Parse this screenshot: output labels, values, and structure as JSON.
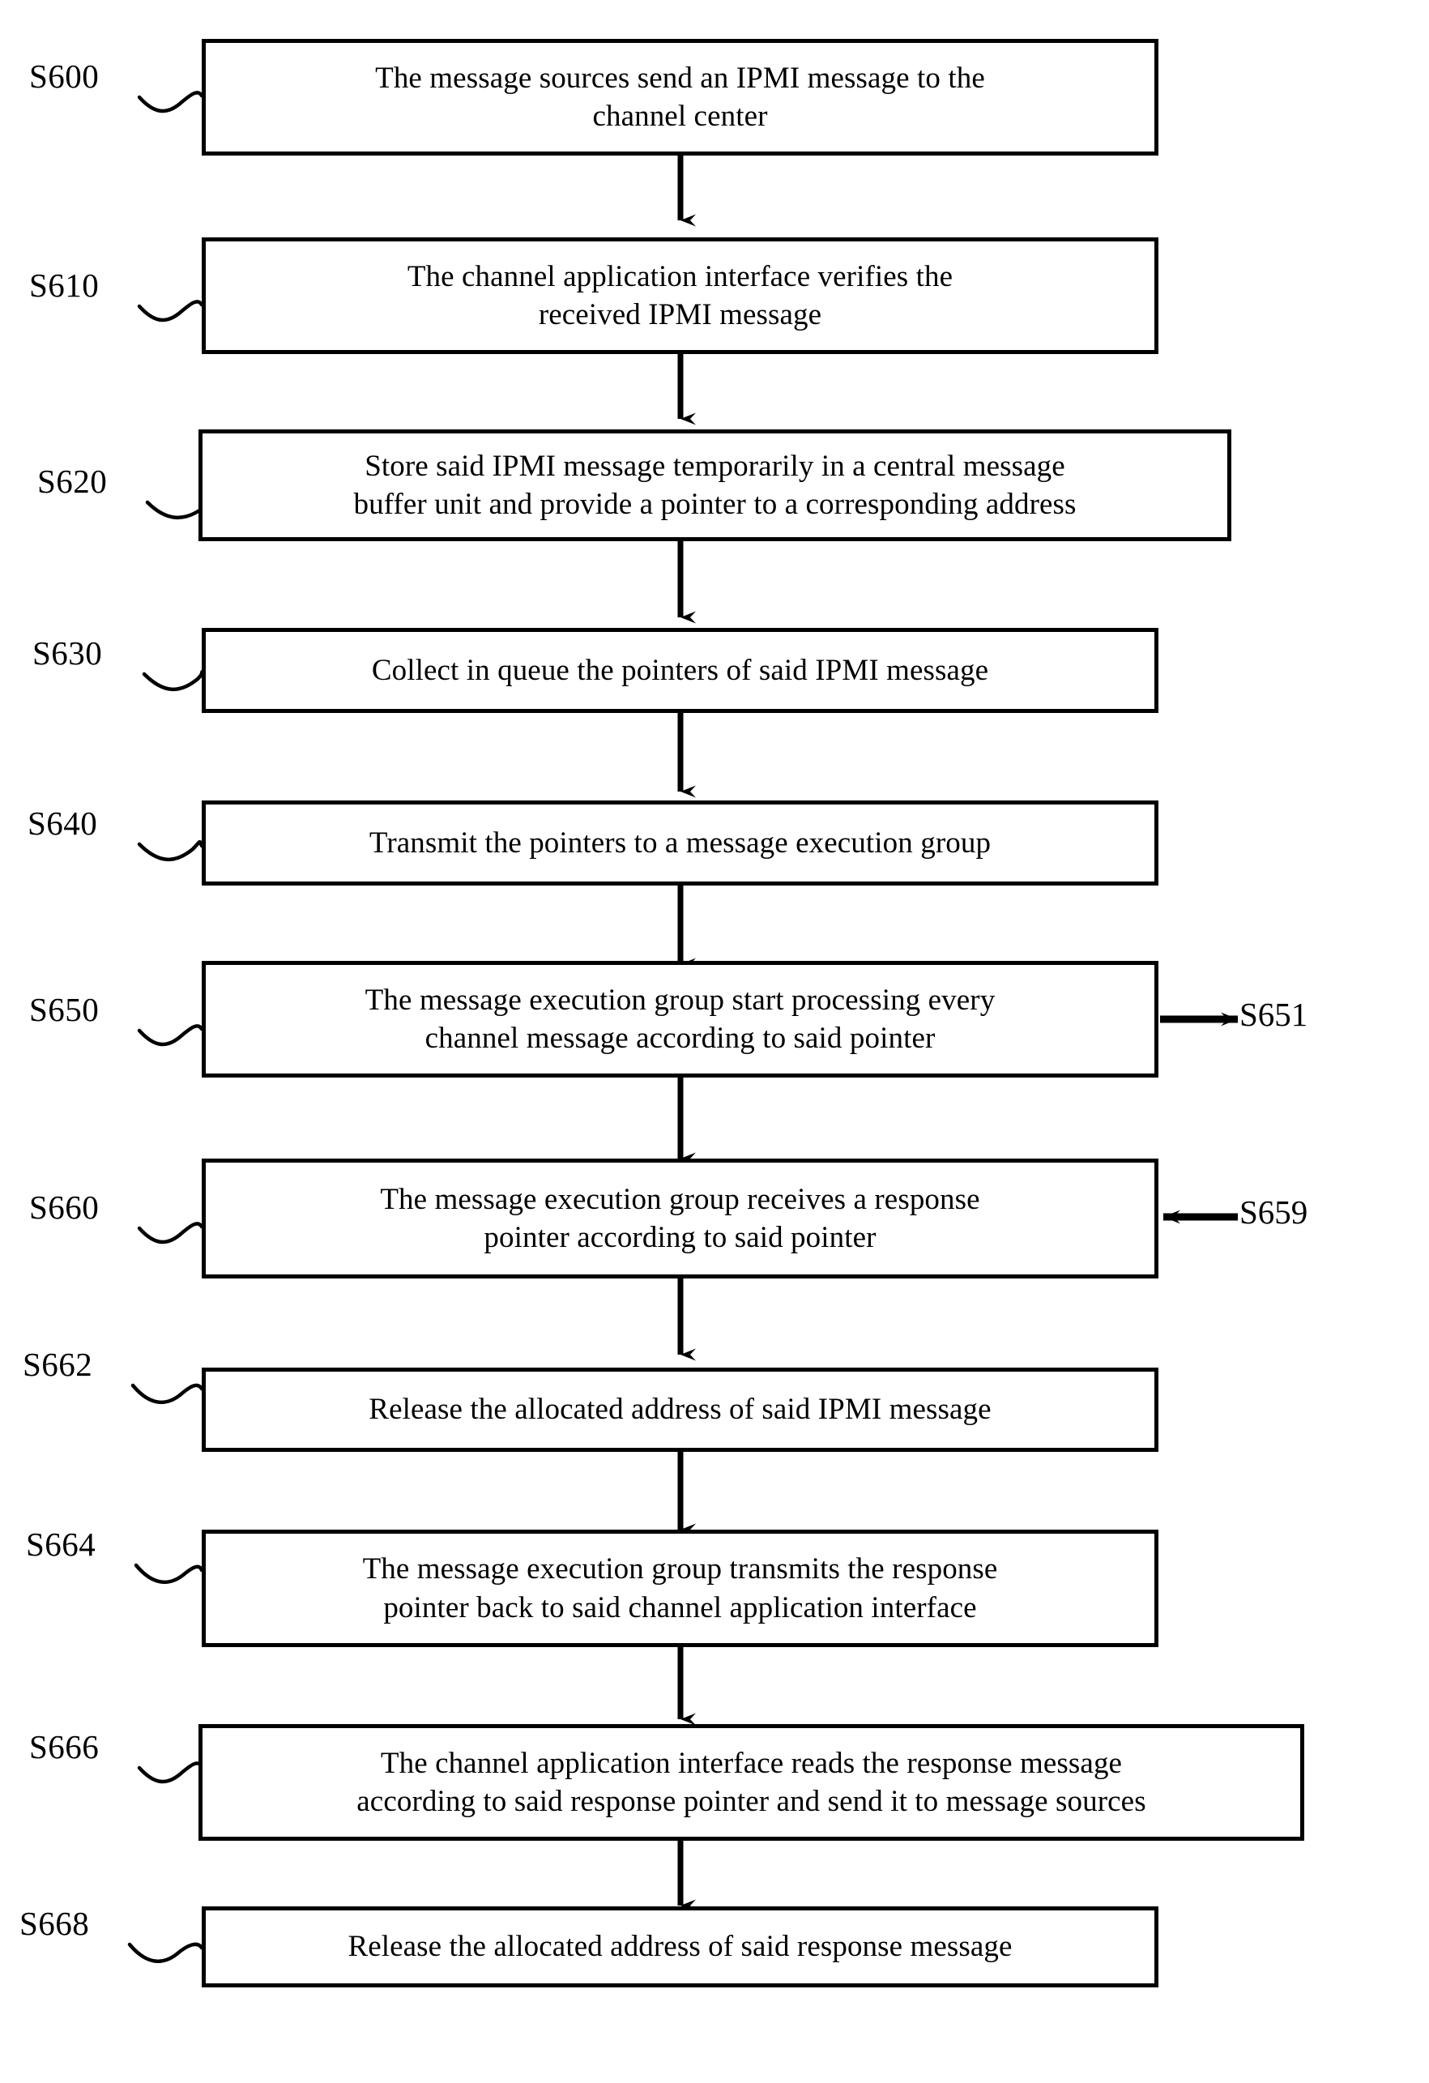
{
  "diagram": {
    "kind": "patent-flowchart",
    "line_color": "#000000",
    "background_color": "#ffffff",
    "nodes": [
      {
        "step": "S600",
        "text": "The message sources send an IPMI message to the\nchannel center"
      },
      {
        "step": "S610",
        "text": "The channel application interface verifies the\nreceived IPMI message"
      },
      {
        "step": "S620",
        "text": "Store said IPMI message temporarily in a central message\nbuffer unit and provide a pointer to a corresponding address"
      },
      {
        "step": "S630",
        "text": "Collect in queue the pointers of said IPMI message"
      },
      {
        "step": "S640",
        "text": "Transmit the pointers to a message execution group"
      },
      {
        "step": "S650",
        "text": "The message execution group start processing every\nchannel message according to said pointer"
      },
      {
        "step": "S660",
        "text": "The message execution group receives a response\npointer according to said pointer"
      },
      {
        "step": "S662",
        "text": "Release the allocated address of said IPMI message"
      },
      {
        "step": "S664",
        "text": "The message execution group transmits the response\npointer back to said channel application interface"
      },
      {
        "step": "S666",
        "text": "The channel application interface reads the response message\naccording to said response pointer and send it to message sources"
      },
      {
        "step": "S668",
        "text": "Release the allocated address of said response message"
      }
    ],
    "side_annotations": [
      {
        "label": "S651",
        "direction": "out-right",
        "attached_to": "S650"
      },
      {
        "label": "S659",
        "direction": "in-left",
        "attached_to": "S660"
      }
    ]
  }
}
